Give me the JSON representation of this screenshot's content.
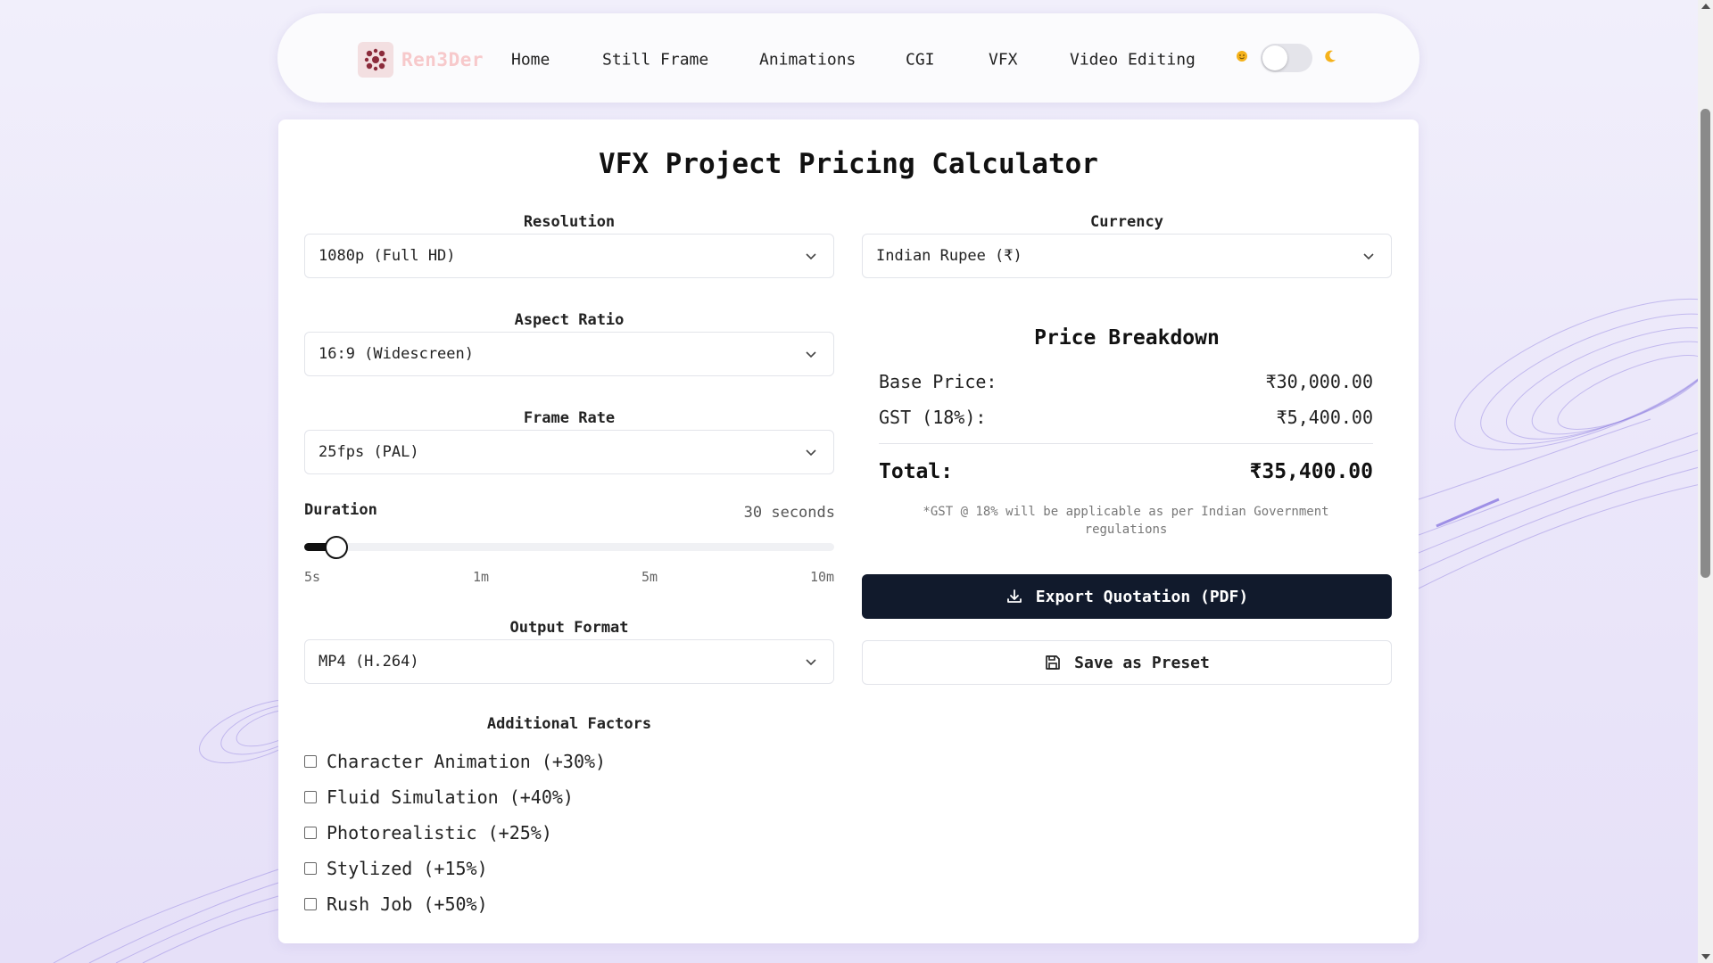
{
  "nav": {
    "brand": "Ren3Der",
    "links": [
      "Home",
      "Still Frame",
      "Animations",
      "CGI",
      "VFX",
      "Video Editing"
    ],
    "theme_light_icon": "sun-icon",
    "theme_dark_icon": "moon-icon",
    "dark_mode": false
  },
  "calculator": {
    "title": "VFX Project Pricing Calculator",
    "resolution": {
      "label": "Resolution",
      "value": "1080p (Full HD)"
    },
    "currency": {
      "label": "Currency",
      "value": "Indian Rupee (₹)"
    },
    "aspect_ratio": {
      "label": "Aspect Ratio",
      "value": "16:9 (Widescreen)"
    },
    "frame_rate": {
      "label": "Frame Rate",
      "value": "25fps (PAL)"
    },
    "duration": {
      "label": "Duration",
      "value_text": "30 seconds",
      "slider_fraction": 0.06,
      "ticks": [
        "5s",
        "1m",
        "5m",
        "10m"
      ]
    },
    "output_format": {
      "label": "Output Format",
      "value": "MP4 (H.264)"
    },
    "additional_factors": {
      "title": "Additional Factors",
      "items": [
        {
          "label": "Character Animation (+30%)",
          "checked": false
        },
        {
          "label": "Fluid Simulation (+40%)",
          "checked": false
        },
        {
          "label": "Photorealistic (+25%)",
          "checked": false
        },
        {
          "label": "Stylized (+15%)",
          "checked": false
        },
        {
          "label": "Rush Job (+50%)",
          "checked": false
        }
      ]
    }
  },
  "price_breakdown": {
    "title": "Price Breakdown",
    "base_label": "Base Price:",
    "base_value": "₹30,000.00",
    "gst_label": "GST (18%):",
    "gst_value": "₹5,400.00",
    "total_label": "Total:",
    "total_value": "₹35,400.00",
    "note": "*GST @ 18% will be applicable as per Indian Government regulations"
  },
  "actions": {
    "export_label": "Export Quotation (PDF)",
    "export_icon": "download-icon",
    "preset_label": "Save as Preset",
    "preset_icon": "save-icon"
  },
  "colors": {
    "accent_dark": "#111a2c",
    "brand_pink": "#f7c9cb",
    "background": "#ece8fa"
  }
}
